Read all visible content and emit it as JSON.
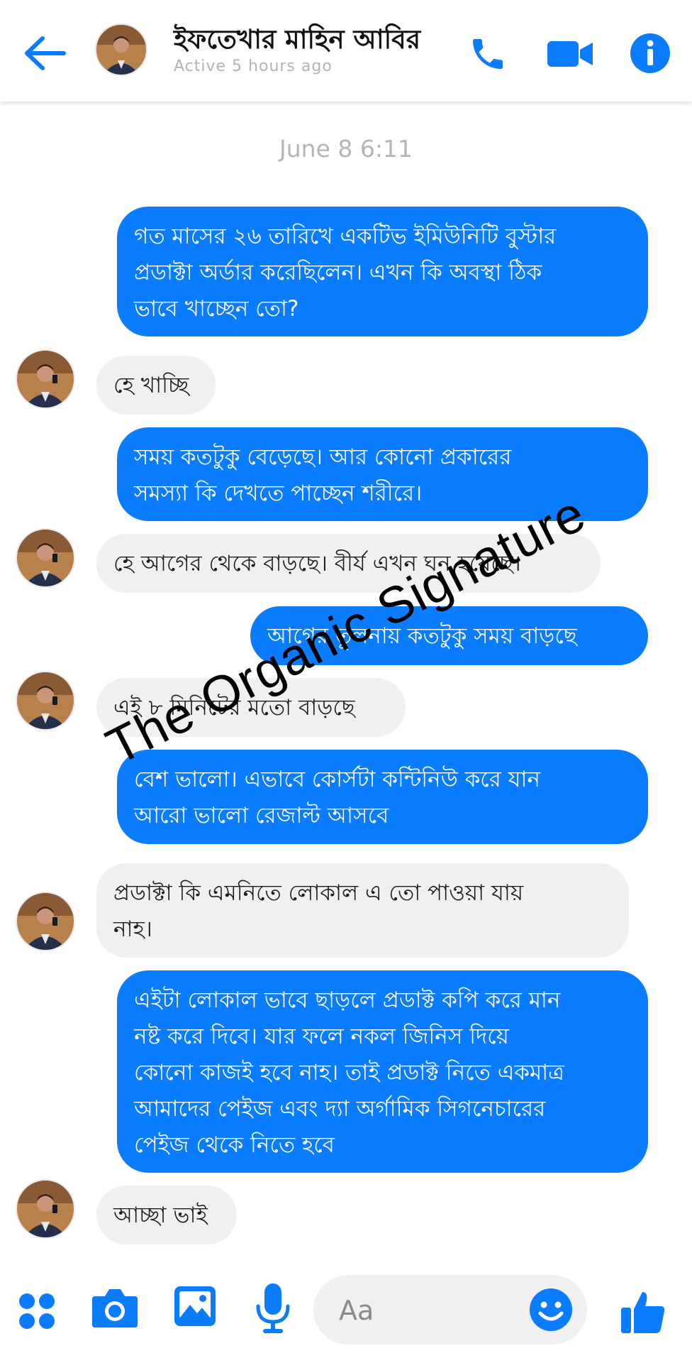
{
  "colors": {
    "accent": "#0a7cff",
    "outgoing_bubble": "#0a7cff",
    "incoming_bubble": "#f0f0f0",
    "status_text": "#b3b3b3"
  },
  "header": {
    "contact_name": "ইফতেখার মাহিন আবির",
    "status": "Active 5 hours ago",
    "icons": [
      "back-arrow-icon",
      "phone-icon",
      "video-camera-icon",
      "info-icon"
    ]
  },
  "conversation": {
    "timestamp": "June 8 6:11",
    "messages": [
      {
        "direction": "outgoing",
        "text": "গত মাসের ২৬ তারিখে একটিভ ইমিউনিটি বুস্টার\nপ্রডাক্টা অর্ডার করেছিলেন। এখন কি অবস্থা ঠিক\nভাবে খাচ্ছেন তো?"
      },
      {
        "direction": "incoming",
        "text": "হে খাচ্ছি"
      },
      {
        "direction": "outgoing",
        "text": "সময় কতটুকু বেড়েছে। আর কোনো প্রকারের\nসমস্যা কি দেখতে পাচ্ছেন শরীরে।"
      },
      {
        "direction": "incoming",
        "text": "হে আগের থেকে বাড়ছে। বীর্য এখন ঘন হয়েছে।"
      },
      {
        "direction": "outgoing",
        "text": "আগের তুলনায় কতটুকু সময় বাড়ছে"
      },
      {
        "direction": "incoming",
        "text": "এই ৮ মিনিটের মতো বাড়ছে"
      },
      {
        "direction": "outgoing",
        "text": "বেশ ভালো। এভাবে কোর্সটা কন্টিনিউ করে যান\nআরো ভালো রেজাল্ট আসবে"
      },
      {
        "direction": "incoming",
        "text": "প্রডাক্টা কি এমনিতে লোকাল এ তো পাওয়া যায়\nনাহ।"
      },
      {
        "direction": "outgoing",
        "text": "এইটা লোকাল ভাবে ছাড়লে প্রডাক্ট কপি করে মান\nনষ্ট করে দিবে। যার ফলে নকল জিনিস দিয়ে\nকোনো কাজই হবে নাহ। তাই প্রডাক্ট নিতে একমাত্র\nআমাদের পেইজ এবং দ্যা অর্গামিক সিগনেচারের\nপেইজ থেকে নিতে হবে"
      },
      {
        "direction": "incoming",
        "text": "আচ্ছা ভাই"
      }
    ]
  },
  "watermark": "The Organic Signature",
  "composer": {
    "placeholder": "Aa",
    "icons": [
      "menu-dots-icon",
      "camera-icon",
      "gallery-icon",
      "microphone-icon",
      "emoji-icon",
      "thumbs-up-icon"
    ]
  }
}
